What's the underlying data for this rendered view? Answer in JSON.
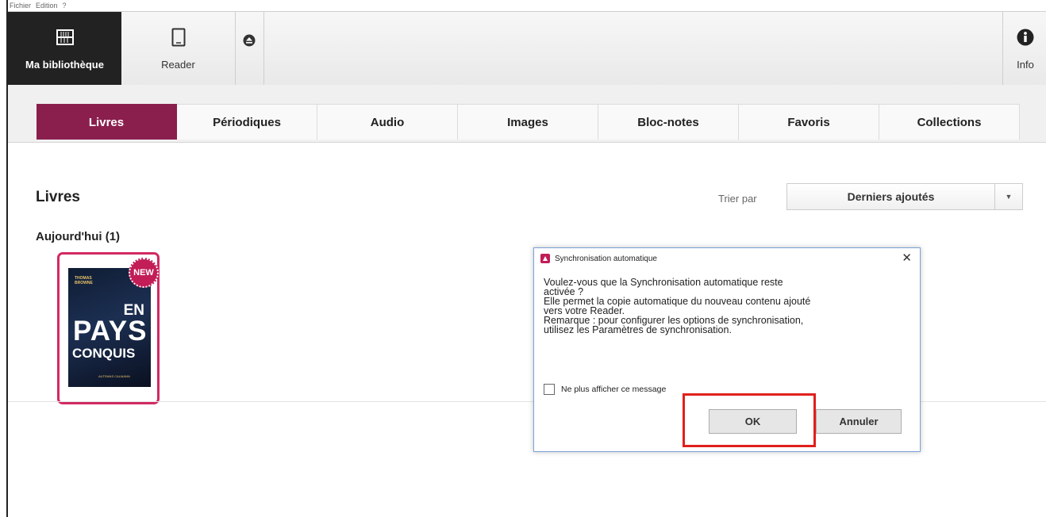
{
  "menu": {
    "items": [
      "Fichier",
      "Edition",
      "?"
    ]
  },
  "toolbar": {
    "library_label": "Ma bibliothèque",
    "reader_label": "Reader",
    "info_label": "Info"
  },
  "tabs": [
    {
      "label": "Livres",
      "active": true
    },
    {
      "label": "Périodiques",
      "active": false
    },
    {
      "label": "Audio",
      "active": false
    },
    {
      "label": "Images",
      "active": false
    },
    {
      "label": "Bloc-notes",
      "active": false
    },
    {
      "label": "Favoris",
      "active": false
    },
    {
      "label": "Collections",
      "active": false
    }
  ],
  "main": {
    "heading": "Livres",
    "section": "Aujourd'hui (1)",
    "sort_label": "Trier par",
    "sort_value": "Derniers ajoutés"
  },
  "book": {
    "badge": "NEW",
    "cover_author": "THOMAS BROWNE",
    "cover_title_1": "EN",
    "cover_title_2": "PAYS",
    "cover_title_3": "CONQUIS",
    "cover_publisher": "AUTRANS CALMANN"
  },
  "dialog": {
    "title": "Synchronisation automatique",
    "close": "✕",
    "lines": [
      "Voulez-vous que la Synchronisation automatique reste",
      "activée ?",
      "Elle permet la copie automatique du nouveau contenu ajouté",
      "vers votre Reader.",
      "Remarque : pour configurer les options de synchronisation,",
      "utilisez les Paramètres de synchronisation."
    ],
    "checkbox_label": "Ne plus afficher ce message",
    "ok": "OK",
    "cancel": "Annuler"
  },
  "colors": {
    "accent": "#8a1f4e",
    "badge": "#c21d57",
    "highlight": "#e0201c"
  }
}
